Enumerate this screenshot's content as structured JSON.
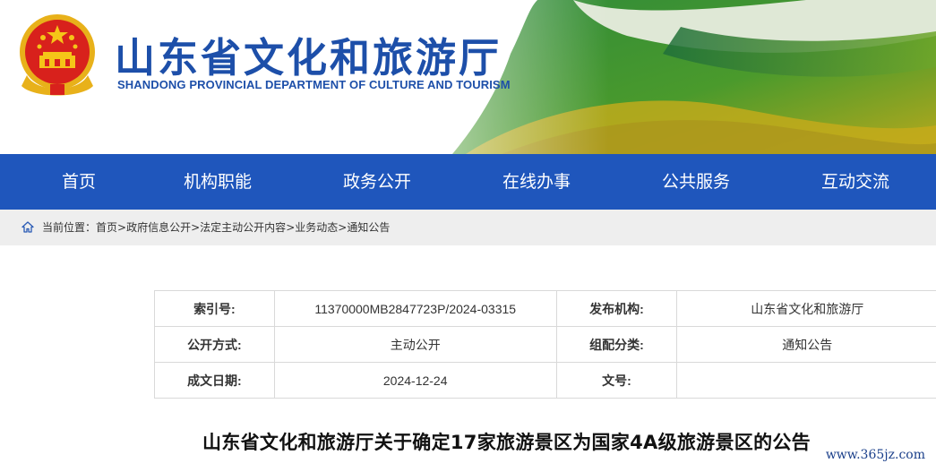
{
  "header": {
    "title": "山东省文化和旅游厅",
    "subtitle": "SHANDONG PROVINCIAL DEPARTMENT OF CULTURE AND  TOURISM"
  },
  "nav": {
    "items": [
      "首页",
      "机构职能",
      "政务公开",
      "在线办事",
      "公共服务",
      "互动交流"
    ]
  },
  "breadcrumb": {
    "prefix": "当前位置：",
    "items": [
      "首页",
      "政府信息公开",
      "法定主动公开内容",
      "业务动态",
      "通知公告"
    ],
    "separator": ">"
  },
  "info": {
    "index_label": "索引号:",
    "index_value": "11370000MB2847723P/2024-03315",
    "publisher_label": "发布机构:",
    "publisher_value": "山东省文化和旅游厅",
    "disclosure_label": "公开方式:",
    "disclosure_value": "主动公开",
    "category_label": "组配分类:",
    "category_value": "通知公告",
    "date_label": "成文日期:",
    "date_value": "2024-12-24",
    "docno_label": "文号:",
    "docno_value": ""
  },
  "article": {
    "title": "山东省文化和旅游厅关于确定17家旅游景区为国家4A级旅游景区的公告"
  },
  "watermark": "www.365jz.com",
  "colors": {
    "brand_blue": "#1f56bc",
    "title_blue": "#1d4fa9",
    "breadcrumb_bg": "#eeeeee"
  }
}
